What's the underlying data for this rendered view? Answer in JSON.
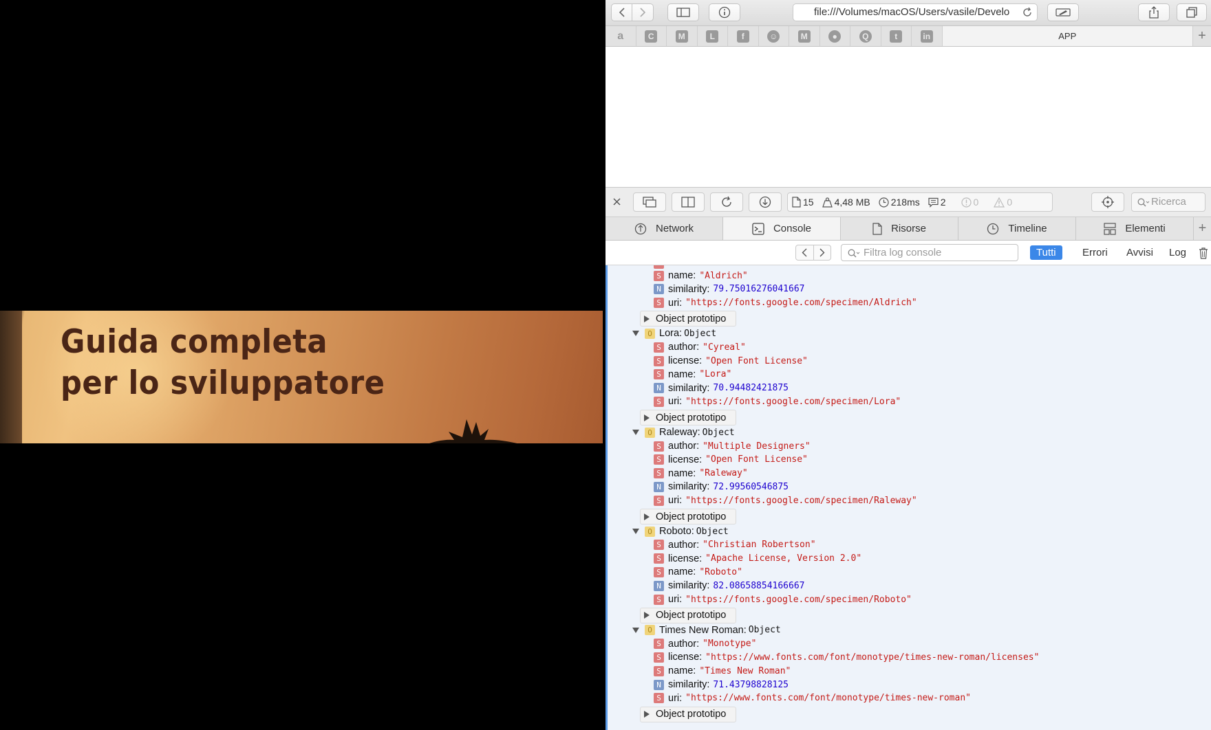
{
  "photo": {
    "title_line1": "Guida completa",
    "title_line2": "per lo sviluppatore"
  },
  "browser": {
    "url": "file:///Volumes/macOS/Users/vasile/Develo",
    "favorites": [
      {
        "icon": "amazon-icon",
        "glyph": "a"
      },
      {
        "icon": "c-icon",
        "glyph": "C"
      },
      {
        "icon": "m-icon",
        "glyph": "M"
      },
      {
        "icon": "l-icon",
        "glyph": "L"
      },
      {
        "icon": "facebook-icon",
        "glyph": "f"
      },
      {
        "icon": "person-icon",
        "glyph": "☺"
      },
      {
        "icon": "m-icon",
        "glyph": "M"
      },
      {
        "icon": "github-icon",
        "glyph": "●"
      },
      {
        "icon": "q-icon",
        "glyph": "Q"
      },
      {
        "icon": "twitter-icon",
        "glyph": "t"
      },
      {
        "icon": "linkedin-icon",
        "glyph": "in"
      }
    ],
    "app_tab_label": "APP"
  },
  "inspector": {
    "stats": {
      "resources": "15",
      "size": "4,48 MB",
      "time": "218ms",
      "logs": "2",
      "errors": "0",
      "warnings": "0"
    },
    "search_placeholder": "Ricerca",
    "tabs": [
      {
        "label": "Network",
        "icon": "network-icon"
      },
      {
        "label": "Console",
        "icon": "console-icon"
      },
      {
        "label": "Risorse",
        "icon": "document-icon"
      },
      {
        "label": "Timeline",
        "icon": "clock-icon"
      },
      {
        "label": "Elementi",
        "icon": "elements-icon"
      }
    ],
    "filter_placeholder": "Filtra log console",
    "filters": [
      "Tutti",
      "Errori",
      "Avvisi",
      "Log"
    ],
    "active_filter": "Tutti"
  },
  "console": {
    "proto_label": "Object prototipo",
    "object_type": "Object",
    "lines_top": [
      {
        "key": "name:",
        "type": "S",
        "value": "\"Aldrich\""
      },
      {
        "key": "similarity:",
        "type": "N",
        "value": "79.75016276041667"
      },
      {
        "key": "uri:",
        "type": "S",
        "value": "\"https://fonts.google.com/specimen/Aldrich\""
      }
    ],
    "objects": [
      {
        "name": "Lora:",
        "props": [
          {
            "key": "author:",
            "type": "S",
            "value": "\"Cyreal\""
          },
          {
            "key": "license:",
            "type": "S",
            "value": "\"Open Font License\""
          },
          {
            "key": "name:",
            "type": "S",
            "value": "\"Lora\""
          },
          {
            "key": "similarity:",
            "type": "N",
            "value": "70.94482421875"
          },
          {
            "key": "uri:",
            "type": "S",
            "value": "\"https://fonts.google.com/specimen/Lora\""
          }
        ]
      },
      {
        "name": "Raleway:",
        "props": [
          {
            "key": "author:",
            "type": "S",
            "value": "\"Multiple Designers\""
          },
          {
            "key": "license:",
            "type": "S",
            "value": "\"Open Font License\""
          },
          {
            "key": "name:",
            "type": "S",
            "value": "\"Raleway\""
          },
          {
            "key": "similarity:",
            "type": "N",
            "value": "72.99560546875"
          },
          {
            "key": "uri:",
            "type": "S",
            "value": "\"https://fonts.google.com/specimen/Raleway\""
          }
        ]
      },
      {
        "name": "Roboto:",
        "props": [
          {
            "key": "author:",
            "type": "S",
            "value": "\"Christian Robertson\""
          },
          {
            "key": "license:",
            "type": "S",
            "value": "\"Apache License, Version 2.0\""
          },
          {
            "key": "name:",
            "type": "S",
            "value": "\"Roboto\""
          },
          {
            "key": "similarity:",
            "type": "N",
            "value": "82.08658854166667"
          },
          {
            "key": "uri:",
            "type": "S",
            "value": "\"https://fonts.google.com/specimen/Roboto\""
          }
        ]
      },
      {
        "name": "Times New Roman:",
        "props": [
          {
            "key": "author:",
            "type": "S",
            "value": "\"Monotype\""
          },
          {
            "key": "license:",
            "type": "S",
            "value": "\"https://www.fonts.com/font/monotype/times-new-roman/licenses\""
          },
          {
            "key": "name:",
            "type": "S",
            "value": "\"Times New Roman\""
          },
          {
            "key": "similarity:",
            "type": "N",
            "value": "71.43798828125"
          },
          {
            "key": "uri:",
            "type": "S",
            "value": "\"https://www.fonts.com/font/monotype/times-new-roman\""
          }
        ]
      }
    ]
  },
  "colors": {
    "string": "#c41a16",
    "number": "#1c00cf",
    "accent": "#3b87e8"
  }
}
